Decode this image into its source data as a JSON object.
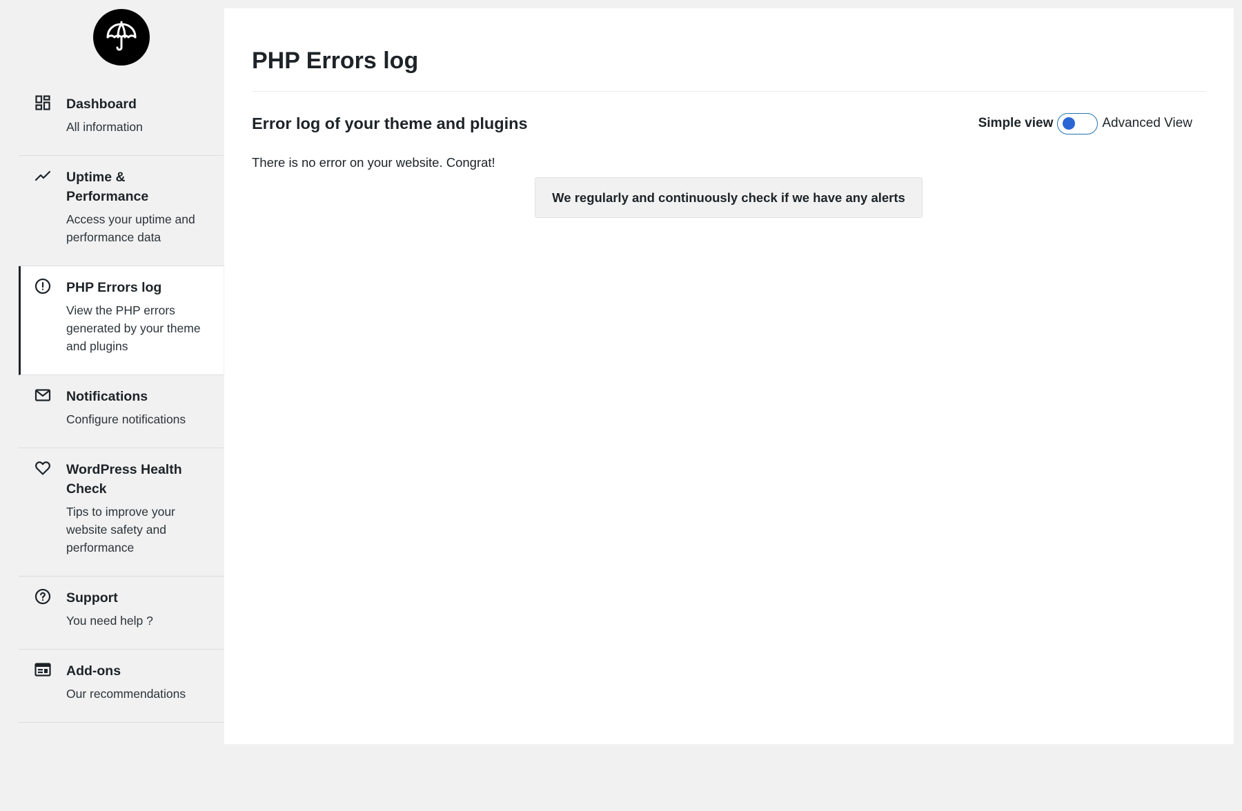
{
  "sidebar": {
    "items": [
      {
        "title": "Dashboard",
        "desc": "All information",
        "icon": "dashboard-icon"
      },
      {
        "title": "Uptime & Performance",
        "desc": "Access your uptime and performance data",
        "icon": "trend-line-icon"
      },
      {
        "title": "PHP Errors log",
        "desc": "View the PHP errors generated by your theme and plugins",
        "icon": "alert-circle-icon",
        "active": true
      },
      {
        "title": "Notifications",
        "desc": "Configure notifications",
        "icon": "mail-icon"
      },
      {
        "title": "WordPress Health Check",
        "desc": "Tips to improve your website safety and performance",
        "icon": "heart-icon"
      },
      {
        "title": "Support",
        "desc": "You need help ?",
        "icon": "help-circle-icon"
      },
      {
        "title": "Add-ons",
        "desc": "Our recommendations",
        "icon": "addons-icon"
      }
    ]
  },
  "main": {
    "title": "PHP Errors log",
    "section_title": "Error log of your theme and plugins",
    "toggle": {
      "left_label": "Simple view",
      "right_label": "Advanced View",
      "state": "simple"
    },
    "no_error_text": "There is no error on your website. Congrat!",
    "alert_text": "We regularly and continuously check if we have any alerts"
  },
  "colors": {
    "background": "#f1f1f1",
    "panel": "#ffffff",
    "text": "#1d2327",
    "toggle_border": "#2271b1",
    "toggle_knob": "#2a66d4",
    "logo": "#000000"
  }
}
